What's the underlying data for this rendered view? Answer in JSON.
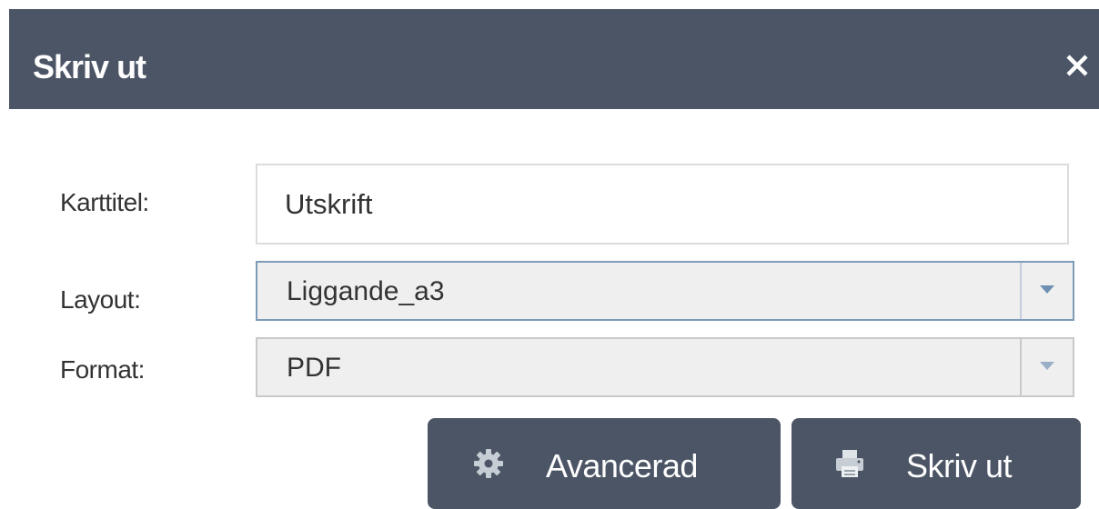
{
  "dialog": {
    "title": "Skriv ut",
    "close_icon": "close-icon"
  },
  "form": {
    "map_title": {
      "label": "Karttitel:",
      "value": "Utskrift"
    },
    "layout": {
      "label": "Layout:",
      "selected": "Liggande_a3"
    },
    "format": {
      "label": "Format:",
      "selected": "PDF"
    }
  },
  "buttons": {
    "advanced": {
      "label": "Avancerad",
      "icon": "gear-icon"
    },
    "print": {
      "label": "Skriv ut",
      "icon": "printer-icon"
    }
  },
  "colors": {
    "header_bg": "#4b5565",
    "button_bg": "#4b5565",
    "select_active_border": "#7e9bb8"
  }
}
